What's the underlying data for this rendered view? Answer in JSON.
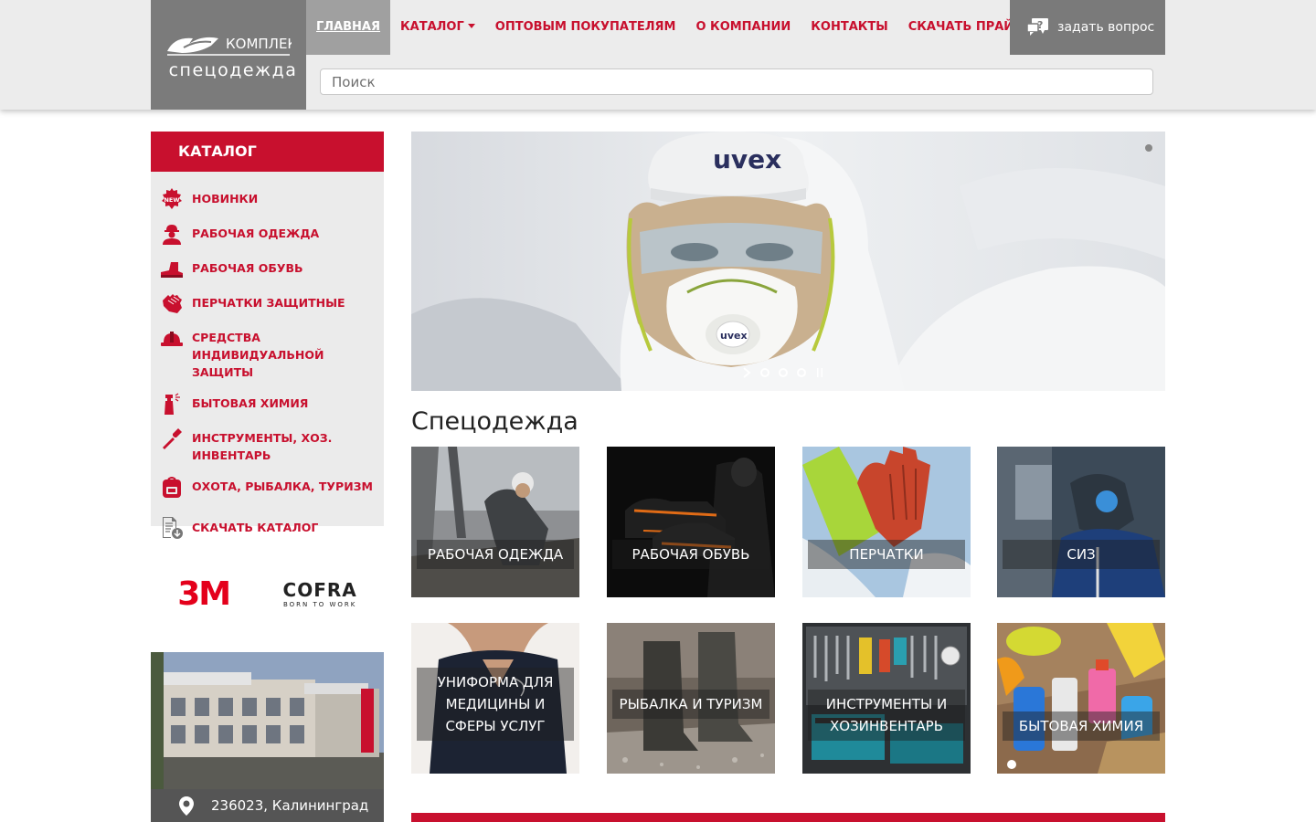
{
  "header": {
    "logo_text": "КОМПЛЕКТ",
    "logo_sub": "спецодежда",
    "nav": [
      {
        "label": "ГЛАВНАЯ",
        "active": true
      },
      {
        "label": "КАТАЛОГ",
        "dropdown": true
      },
      {
        "label": "ОПТОВЫМ ПОКУПАТЕЛЯМ"
      },
      {
        "label": "О КОМПАНИИ"
      },
      {
        "label": "КОНТАКТЫ"
      },
      {
        "label": "СКАЧАТЬ ПРАЙС ЛИСТ"
      }
    ],
    "ask_button": "задать вопрос",
    "search_placeholder": "Поиск"
  },
  "sidebar": {
    "title": "КАТАЛОГ",
    "items": [
      {
        "label": "НОВИНКИ",
        "icon": "new-badge-icon"
      },
      {
        "label": "РАБОЧАЯ ОДЕЖДА",
        "icon": "worker-icon"
      },
      {
        "label": "РАБОЧАЯ ОБУВЬ",
        "icon": "boot-icon"
      },
      {
        "label": "ПЕРЧАТКИ ЗАЩИТНЫЕ",
        "icon": "glove-icon"
      },
      {
        "label": "СРЕДСТВА ИНДИВИДУАЛЬНОЙ ЗАЩИТЫ",
        "icon": "hardhat-icon"
      },
      {
        "label": "БЫТОВАЯ ХИМИЯ",
        "icon": "spray-bottle-icon"
      },
      {
        "label": "ИНСТРУМЕНТЫ, ХОЗ. ИНВЕНТАРЬ",
        "icon": "tool-icon"
      },
      {
        "label": "ОХОТА, РЫБАЛКА, ТУРИЗМ",
        "icon": "backpack-icon"
      },
      {
        "label": "СКАЧАТЬ КАТАЛОГ",
        "icon": "download-doc-icon"
      }
    ],
    "brands": {
      "brand1": "3M",
      "brand2": "COFRA",
      "brand2_tagline": "BORN TO WORK"
    },
    "address": "236023, Калининград"
  },
  "slider": {
    "brand_text": "uvex"
  },
  "main": {
    "section_title": "Спецодежда",
    "tiles": [
      {
        "label": "РАБОЧАЯ ОДЕЖДА"
      },
      {
        "label": "РАБОЧАЯ ОБУВЬ"
      },
      {
        "label": "ПЕРЧАТКИ"
      },
      {
        "label": "СИЗ"
      },
      {
        "label": "УНИФОРМА ДЛЯ МЕДИЦИНЫ И СФЕРЫ УСЛУГ"
      },
      {
        "label": "РЫБАЛКА И ТУРИЗМ"
      },
      {
        "label": "ИНСТРУМЕНТЫ И ХОЗИНВЕНТАРЬ"
      },
      {
        "label": "БЫТОВАЯ ХИМИЯ"
      }
    ]
  },
  "colors": {
    "accent": "#c8102e",
    "header_bg": "#ececec",
    "logo_bg": "#7b7b7b"
  }
}
